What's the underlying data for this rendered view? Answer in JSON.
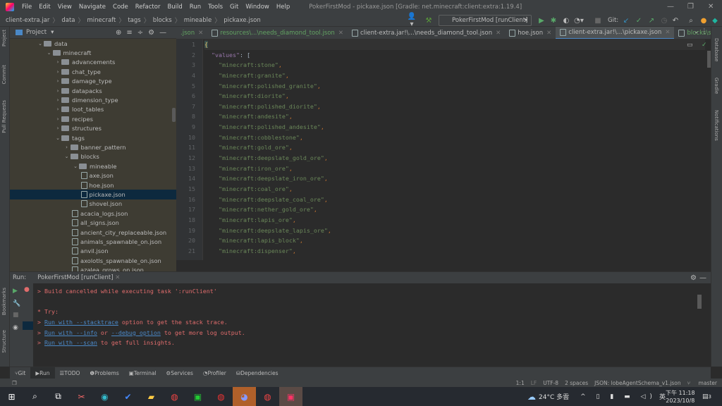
{
  "menu": {
    "items": [
      "File",
      "Edit",
      "View",
      "Navigate",
      "Code",
      "Refactor",
      "Build",
      "Run",
      "Tools",
      "Git",
      "Window",
      "Help"
    ],
    "title": "PokerFirstMod - pickaxe.json [Gradle: net.minecraft:client:extra:1.19.4]"
  },
  "breadcrumb": [
    "client-extra.jar",
    "data",
    "minecraft",
    "tags",
    "blocks",
    "mineable",
    "pickaxe.json"
  ],
  "toolbar": {
    "run_config": "PokerFirstMod [runClient]",
    "git_label": "Git:"
  },
  "project": {
    "title": "Project",
    "tree": [
      {
        "label": "data",
        "depth": 0,
        "type": "folder",
        "open": true
      },
      {
        "label": "minecraft",
        "depth": 1,
        "type": "folder",
        "open": true
      },
      {
        "label": "advancements",
        "depth": 2,
        "type": "folder"
      },
      {
        "label": "chat_type",
        "depth": 2,
        "type": "folder"
      },
      {
        "label": "damage_type",
        "depth": 2,
        "type": "folder"
      },
      {
        "label": "datapacks",
        "depth": 2,
        "type": "folder"
      },
      {
        "label": "dimension_type",
        "depth": 2,
        "type": "folder"
      },
      {
        "label": "loot_tables",
        "depth": 2,
        "type": "folder"
      },
      {
        "label": "recipes",
        "depth": 2,
        "type": "folder"
      },
      {
        "label": "structures",
        "depth": 2,
        "type": "folder"
      },
      {
        "label": "tags",
        "depth": 2,
        "type": "folder",
        "open": true
      },
      {
        "label": "banner_pattern",
        "depth": 3,
        "type": "folder"
      },
      {
        "label": "blocks",
        "depth": 3,
        "type": "folder",
        "open": true
      },
      {
        "label": "mineable",
        "depth": 4,
        "type": "folder",
        "open": true
      },
      {
        "label": "axe.json",
        "depth": 5,
        "type": "file"
      },
      {
        "label": "hoe.json",
        "depth": 5,
        "type": "file"
      },
      {
        "label": "pickaxe.json",
        "depth": 5,
        "type": "file",
        "selected": true
      },
      {
        "label": "shovel.json",
        "depth": 5,
        "type": "file"
      },
      {
        "label": "acacia_logs.json",
        "depth": 4,
        "type": "file"
      },
      {
        "label": "all_signs.json",
        "depth": 4,
        "type": "file"
      },
      {
        "label": "ancient_city_replaceable.json",
        "depth": 4,
        "type": "file"
      },
      {
        "label": "animals_spawnable_on.json",
        "depth": 4,
        "type": "file"
      },
      {
        "label": "anvil.json",
        "depth": 4,
        "type": "file"
      },
      {
        "label": "axolotls_spawnable_on.json",
        "depth": 4,
        "type": "file"
      },
      {
        "label": "azalea_grows_on.json",
        "depth": 4,
        "type": "file"
      }
    ]
  },
  "tabs": [
    {
      "label": ".json",
      "style": "green"
    },
    {
      "label": "resources\\...\\needs_diamond_tool.json",
      "style": "green"
    },
    {
      "label": "client-extra.jar!\\...\\needs_diamond_tool.json",
      "style": "normal"
    },
    {
      "label": "hoe.json",
      "style": "normal"
    },
    {
      "label": "client-extra.jar!\\...\\pickaxe.json",
      "style": "active"
    },
    {
      "label": "blocks\\silver_block.json",
      "style": "green"
    }
  ],
  "editor": {
    "key": "\"values\"",
    "values": [
      "minecraft:stone",
      "minecraft:granite",
      "minecraft:polished_granite",
      "minecraft:diorite",
      "minecraft:polished_diorite",
      "minecraft:andesite",
      "minecraft:polished_andesite",
      "minecraft:cobblestone",
      "minecraft:gold_ore",
      "minecraft:deepslate_gold_ore",
      "minecraft:iron_ore",
      "minecraft:deepslate_iron_ore",
      "minecraft:coal_ore",
      "minecraft:deepslate_coal_ore",
      "minecraft:nether_gold_ore",
      "minecraft:lapis_ore",
      "minecraft:deepslate_lapis_ore",
      "minecraft:lapis_block",
      "minecraft:dispenser"
    ]
  },
  "left_strip": [
    "Project",
    "Commit",
    "Pull Requests",
    "Bookmarks",
    "Structure"
  ],
  "right_strip": [
    "Database",
    "Gradle",
    "Notifications"
  ],
  "run": {
    "label": "Run:",
    "tab": "PokerFirstMod [runClient]",
    "console": {
      "line1": "> Build cancelled while executing task ':runClient'",
      "try": "* Try:",
      "l1_link": "Run with --stacktrace",
      "l1_rest": " option to get the stack trace.",
      "l2_link": "Run with --info",
      "l2_mid": " or ",
      "l2_link2": "--debug option",
      "l2_rest": " to get more log output.",
      "l3_link": "Run with --scan",
      "l3_rest": " to get full insights.",
      "prompt": "> "
    }
  },
  "bottom_tabs": [
    "Git",
    "Run",
    "TODO",
    "Problems",
    "Terminal",
    "Services",
    "Profiler",
    "Dependencies"
  ],
  "status": {
    "position": "1:1",
    "line_sep": "LF",
    "encoding": "UTF-8",
    "indent": "2 spaces",
    "schema": "JSON: lobeAgentSchema_v1.json",
    "branch": "master"
  },
  "taskbar": {
    "weather": "24°C 多雲",
    "ime": "英",
    "time": "下午 11:18",
    "date": "2023/10/8",
    "notifications": "3"
  }
}
